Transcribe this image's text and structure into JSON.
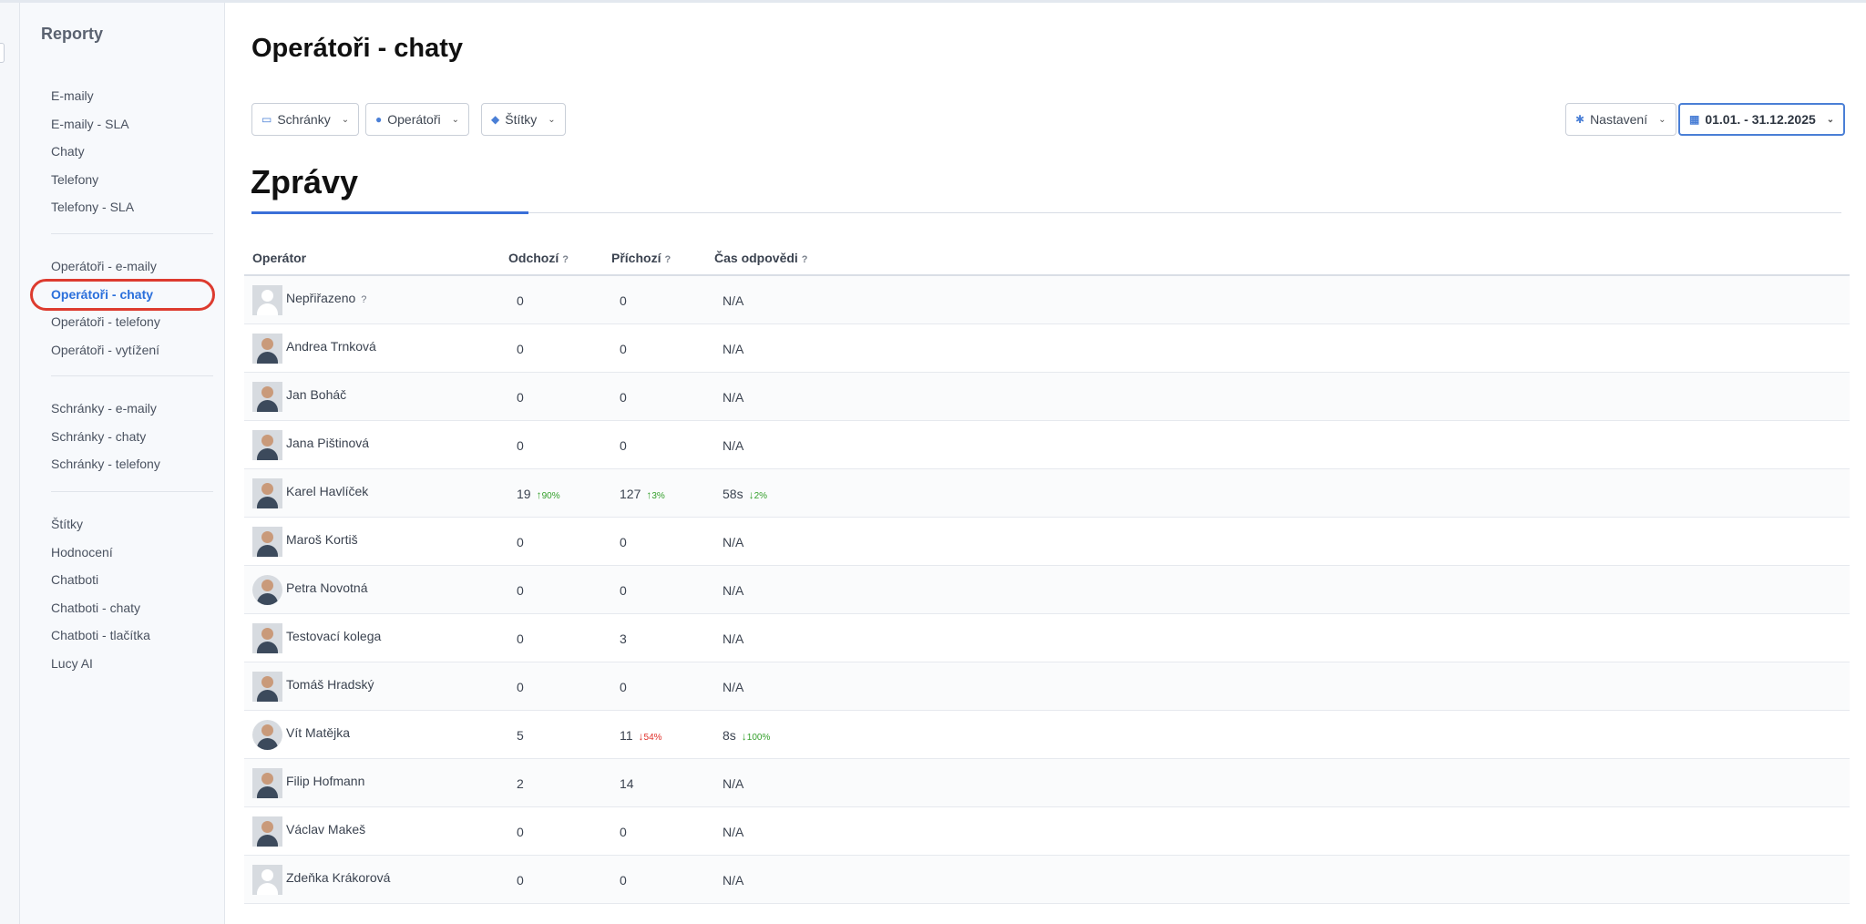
{
  "sidebar": {
    "title": "Reporty",
    "group1": [
      "E-maily",
      "E-maily - SLA",
      "Chaty",
      "Telefony",
      "Telefony - SLA"
    ],
    "group2": [
      "Operátoři - e-maily",
      "Operátoři - chaty",
      "Operátoři - telefony",
      "Operátoři - vytížení"
    ],
    "group3": [
      "Schránky - e-maily",
      "Schránky - chaty",
      "Schránky - telefony"
    ],
    "group4": [
      "Štítky",
      "Hodnocení",
      "Chatboti",
      "Chatboti - chaty",
      "Chatboti - tlačítka",
      "Lucy AI"
    ],
    "active_item": "Operátoři - chaty"
  },
  "page": {
    "title": "Operátoři - chaty",
    "section_title": "Zprávy"
  },
  "filters": {
    "mailboxes": "Schránky",
    "operators": "Operátoři",
    "tags": "Štítky",
    "settings": "Nastavení",
    "date_range": "01.01. - 31.12.2025"
  },
  "icons": {
    "mailboxes": "inbox-icon",
    "operators": "user-icon",
    "tags": "tags-icon",
    "settings": "gear-icon",
    "date": "calendar-icon"
  },
  "colors": {
    "accent": "#3a6fd8",
    "active_nav": "#2a6fdb",
    "highlight_ring": "#dd3b2f",
    "trend_up": "#35a02c",
    "trend_down": "#e0302a"
  },
  "table": {
    "headers": [
      "Operátor",
      "Odchozí",
      "Příchozí",
      "Čas odpovědi"
    ],
    "rows": [
      {
        "name": "Nepřiřazeno",
        "outgoing": "0",
        "incoming": "0",
        "response": "N/A"
      },
      {
        "name": "Andrea Trnková",
        "outgoing": "0",
        "incoming": "0",
        "response": "N/A"
      },
      {
        "name": "Jan Boháč",
        "outgoing": "0",
        "incoming": "0",
        "response": "N/A"
      },
      {
        "name": "Jana Pištinová",
        "outgoing": "0",
        "incoming": "0",
        "response": "N/A"
      },
      {
        "name": "Karel Havlíček",
        "outgoing": "19",
        "outgoing_delta": "90%",
        "incoming": "127",
        "incoming_delta": "3%",
        "response": "58s",
        "response_delta": "2%"
      },
      {
        "name": "Maroš Kortiš",
        "outgoing": "0",
        "incoming": "0",
        "response": "N/A"
      },
      {
        "name": "Petra Novotná",
        "outgoing": "0",
        "incoming": "0",
        "response": "N/A"
      },
      {
        "name": "Testovací kolega",
        "outgoing": "0",
        "incoming": "3",
        "response": "N/A"
      },
      {
        "name": "Tomáš Hradský",
        "outgoing": "0",
        "incoming": "0",
        "response": "N/A"
      },
      {
        "name": "Vít Matějka",
        "outgoing": "5",
        "incoming": "11",
        "incoming_delta": "54%",
        "response": "8s",
        "response_delta": "100%"
      },
      {
        "name": "Filip Hofmann",
        "outgoing": "2",
        "incoming": "14",
        "response": "N/A"
      },
      {
        "name": "Václav Makeš",
        "outgoing": "0",
        "incoming": "0",
        "response": "N/A"
      },
      {
        "name": "Zdeňka Krákorová",
        "outgoing": "0",
        "incoming": "0",
        "response": "N/A"
      }
    ]
  }
}
